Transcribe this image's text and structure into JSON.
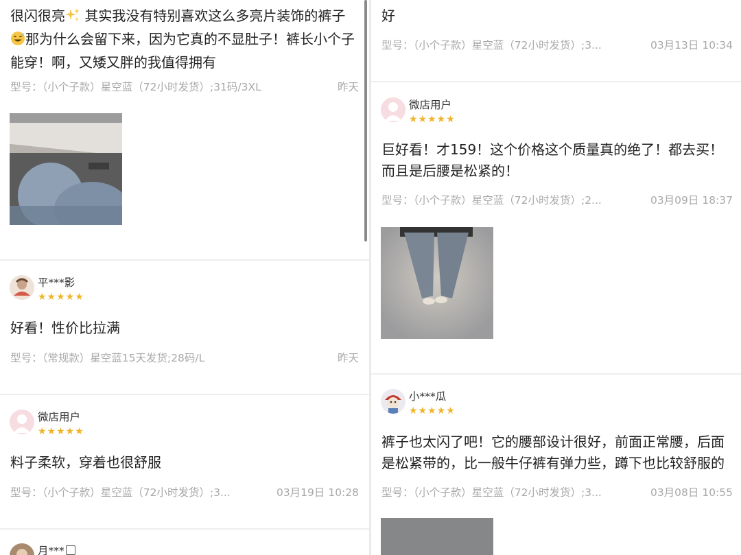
{
  "left": {
    "review1": {
      "text_a": "很闪很亮",
      "text_b": "其实我没有特别喜欢这么多亮片装饰的裤子",
      "text_c": "那为什么会留下来，因为它真的不显肚子！裤长小个子能穿！啊，又矮又胖的我值得拥有",
      "meta": "型号：（小个子款）星空蓝（72小时发货）;31码/3XL",
      "date": "昨天"
    },
    "review2": {
      "user": "平***影",
      "stars": "★★★★★",
      "text": "好看！性价比拉满",
      "meta": "型号：（常规款）星空蓝15天发货;28码/L",
      "date": "昨天"
    },
    "review3": {
      "user": "微店用户",
      "stars": "★★★★★",
      "text": "料子柔软，穿着也很舒服",
      "meta": "型号：（小个子款）星空蓝（72小时发货）;3...",
      "date": "03月19日 10:28"
    },
    "review4": {
      "user": "月***"
    }
  },
  "right": {
    "review1": {
      "text": "好",
      "meta": "型号：（小个子款）星空蓝（72小时发货）;3...",
      "date": "03月13日 10:34"
    },
    "review2": {
      "user": "微店用户",
      "stars": "★★★★★",
      "text": "巨好看！才159！这个价格这个质量真的绝了！都去买！而且是后腰是松紧的！",
      "meta": "型号：（小个子款）星空蓝（72小时发货）;2...",
      "date": "03月09日 18:37"
    },
    "review3": {
      "user": "小***瓜",
      "stars": "★★★★★",
      "text": "裤子也太闪了吧！它的腰部设计很好，前面正常腰，后面是松紧带的，比一般牛仔裤有弹力些，蹲下也比较舒服的",
      "meta": "型号：（小个子款）星空蓝（72小时发货）;3...",
      "date": "03月08日 10:55"
    }
  },
  "colors": {
    "star": "#f0b429",
    "meta_text": "#a9a9a9",
    "separator": "#eeeeee"
  },
  "icons": {
    "sparkle": "sparkles-emoji",
    "sweat_smile": "sweat-smile-emoji"
  }
}
